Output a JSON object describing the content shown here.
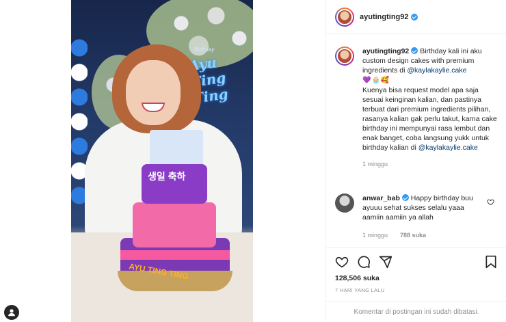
{
  "post": {
    "username": "ayutingting92",
    "verified": true,
    "caption_line1_text": "Birthday kali ini aku custom design cakes with premium ingredients di ",
    "caption_link1": "@kaylakaylie.cake",
    "caption_emojis": "💜🧁🥰",
    "caption_rest": "Kuenya bisa request model apa saja sesuai keinginan kalian, dan pastinya terbuat dari premium ingredients pilihan, rasanya kalian gak perlu takut, karna cake birthday ini mempunyai rasa lembut dan enak banget, coba langsung yukk untuk birthday kalian di ",
    "caption_link2": "@kaylakaylie.cake",
    "caption_time": "1 minggu",
    "likes": "128,506 suka",
    "posted": "7 HARI YANG LALU",
    "footer_note": "Komentar di postingan ini sudah dibatasi."
  },
  "comment": {
    "username": "anwar_bab",
    "verified": true,
    "text": "Happy birthday buu ayuuu sehat sukses selalu yaaa aamiin aamiin ya allah",
    "time": "1 minggu",
    "likes": "788 suka"
  },
  "photo": {
    "sign_top": "Birthday",
    "sign_name": "Ayu Ting Ting",
    "cake_korean": "생일 축하",
    "cake_name": "AYU TING TING"
  },
  "icons": {
    "like": "heart-icon",
    "comment": "comment-icon",
    "share": "share-icon",
    "save": "bookmark-icon",
    "user": "user-icon"
  },
  "colors": {
    "verified": "#3897f0",
    "link": "#00376b",
    "muted": "#8e8e8e"
  }
}
